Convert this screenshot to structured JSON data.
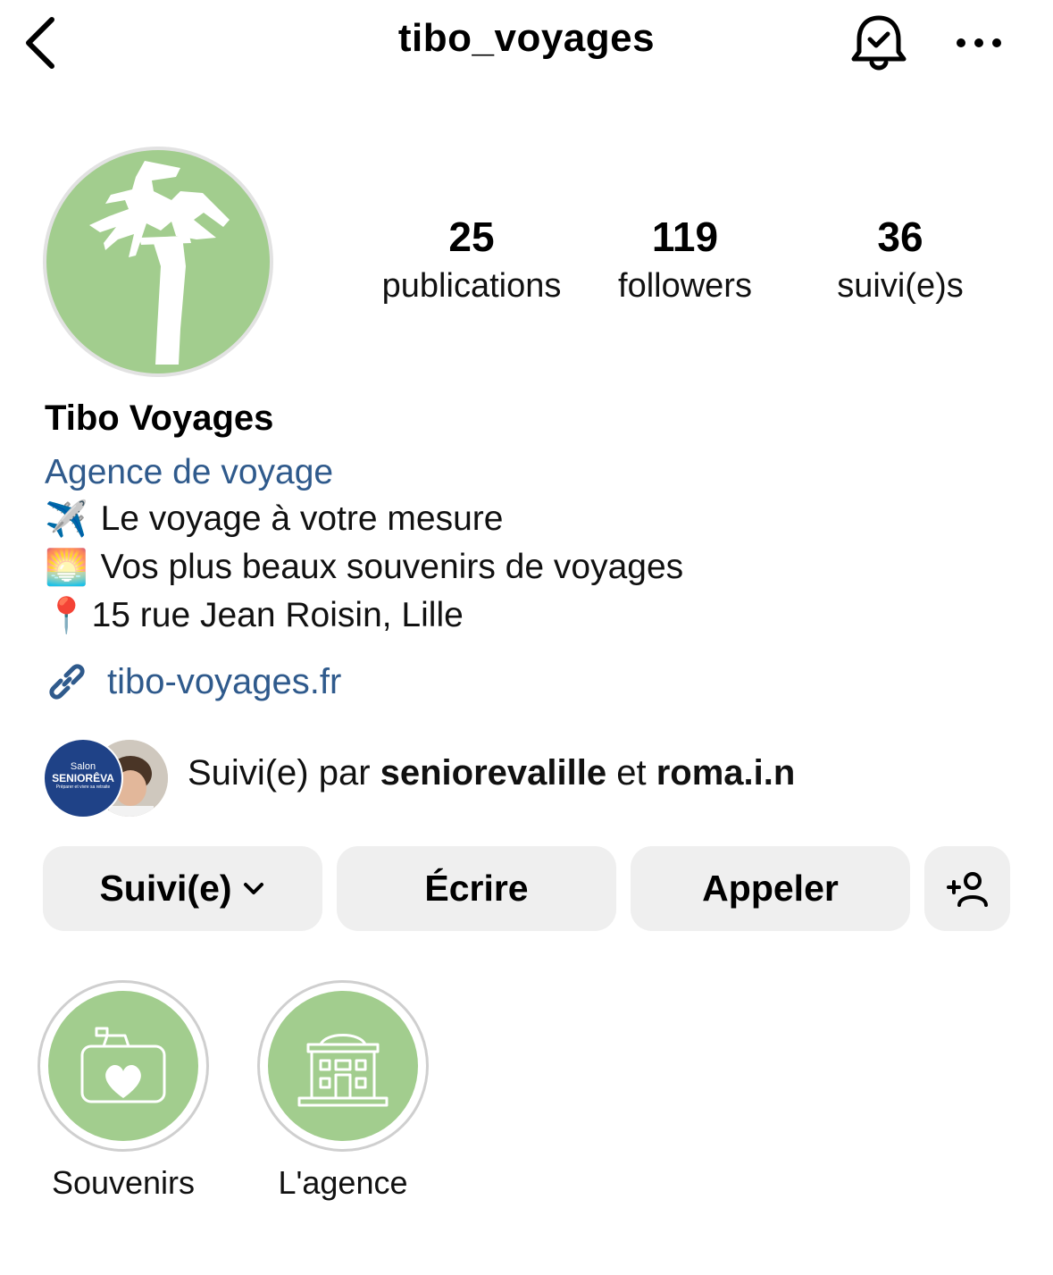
{
  "header": {
    "username": "tibo_voyages",
    "back_icon": "chevron-left-icon",
    "bell_icon": "bell-check-icon",
    "more_icon": "more-horizontal-icon"
  },
  "profile": {
    "avatar_icon": "palm-tree-logo",
    "avatar_color": "#a2cd8e"
  },
  "stats": {
    "posts": {
      "count": "25",
      "label": "publications"
    },
    "followers": {
      "count": "119",
      "label": "followers"
    },
    "following": {
      "count": "36",
      "label": "suivi(e)s"
    }
  },
  "bio": {
    "name": "Tibo Voyages",
    "category": "Agence de voyage",
    "lines": [
      {
        "emoji": "✈️",
        "text": "Le voyage à votre mesure"
      },
      {
        "emoji": "🌅",
        "text": "Vos plus beaux souvenirs de voyages"
      },
      {
        "emoji": "📍",
        "text": "15 rue Jean Roisin, Lille"
      }
    ],
    "link": "tibo-voyages.fr"
  },
  "followed_by": {
    "prefix": "Suivi(e) par ",
    "user1": "seniorevalille",
    "joiner": " et ",
    "user2": "roma.i.n",
    "avatar1_text_small": "Salon",
    "avatar1_text_big": "SENIORÊVA",
    "avatar1_text_tiny": "Préparer et vivre sa retraite"
  },
  "actions": {
    "follow": "Suivi(e)",
    "message": "Écrire",
    "call": "Appeler",
    "add_user_icon": "add-user-icon"
  },
  "highlights": [
    {
      "label": "Souvenirs",
      "icon": "camera-heart-icon"
    },
    {
      "label": "L'agence",
      "icon": "building-icon"
    }
  ],
  "colors": {
    "link_blue": "#2f5a8c",
    "button_bg": "#efefef",
    "brand_green": "#a2cd8e"
  }
}
